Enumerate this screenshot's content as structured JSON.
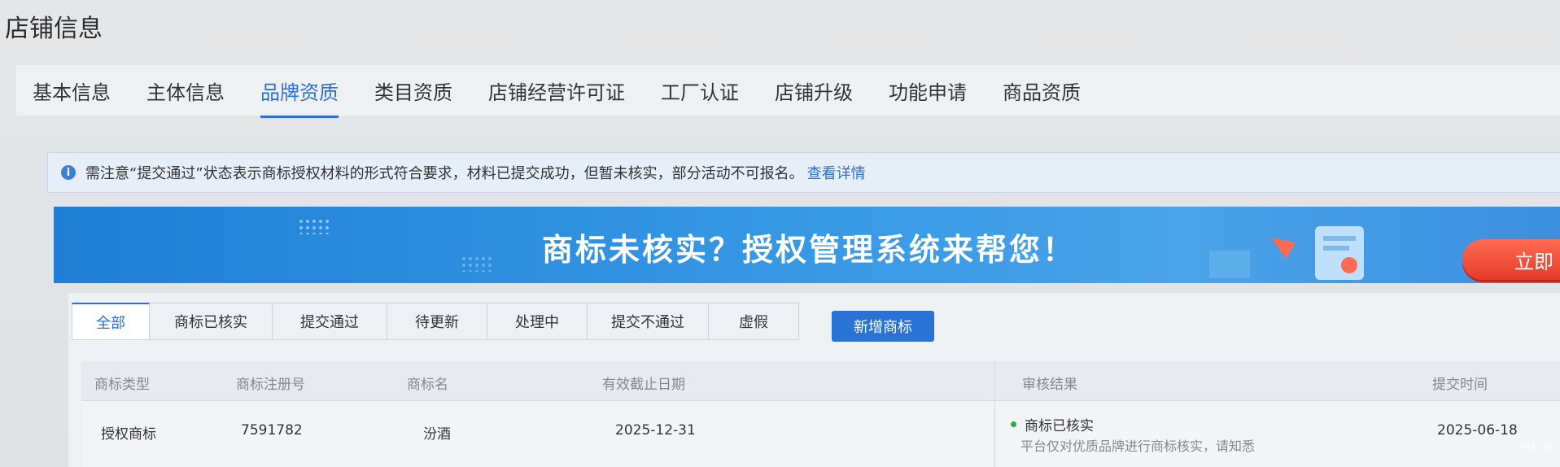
{
  "page": {
    "title": "店铺信息"
  },
  "tabs": [
    {
      "label": "基本信息",
      "active": false
    },
    {
      "label": "主体信息",
      "active": false
    },
    {
      "label": "品牌资质",
      "active": true
    },
    {
      "label": "类目资质",
      "active": false
    },
    {
      "label": "店铺经营许可证",
      "active": false
    },
    {
      "label": "工厂认证",
      "active": false
    },
    {
      "label": "店铺升级",
      "active": false
    },
    {
      "label": "功能申请",
      "active": false
    },
    {
      "label": "商品资质",
      "active": false
    }
  ],
  "notice": {
    "icon": "info-icon",
    "text": "需注意“提交通过”状态表示商标授权材料的形式符合要求，材料已提交成功，但暂未核实，部分活动不可报名。",
    "link": "查看详情"
  },
  "banner": {
    "text": "商标未核实？授权管理系统来帮您！",
    "cta": "立即"
  },
  "filters": [
    {
      "label": "全部",
      "active": true
    },
    {
      "label": "商标已核实",
      "active": false
    },
    {
      "label": "提交通过",
      "active": false
    },
    {
      "label": "待更新",
      "active": false
    },
    {
      "label": "处理中",
      "active": false
    },
    {
      "label": "提交不通过",
      "active": false
    },
    {
      "label": "虚假",
      "active": false
    }
  ],
  "add_button": "新增商标",
  "table": {
    "columns": [
      "商标类型",
      "商标注册号",
      "商标名",
      "有效截止日期",
      "审核结果",
      "提交时间"
    ],
    "rows": [
      {
        "type": "授权商标",
        "reg_no": "7591782",
        "name": "汾酒",
        "expiry": "2025-12-31",
        "result": "商标已核实",
        "result_desc": "平台仅对优质品牌进行商标核实，请知悉",
        "submit_time": "2025-06-18"
      }
    ]
  },
  "watermark": "小红书",
  "colors": {
    "accent": "#2c6fd6",
    "status_ok": "#2aa84a",
    "cta": "#e63b2a"
  }
}
